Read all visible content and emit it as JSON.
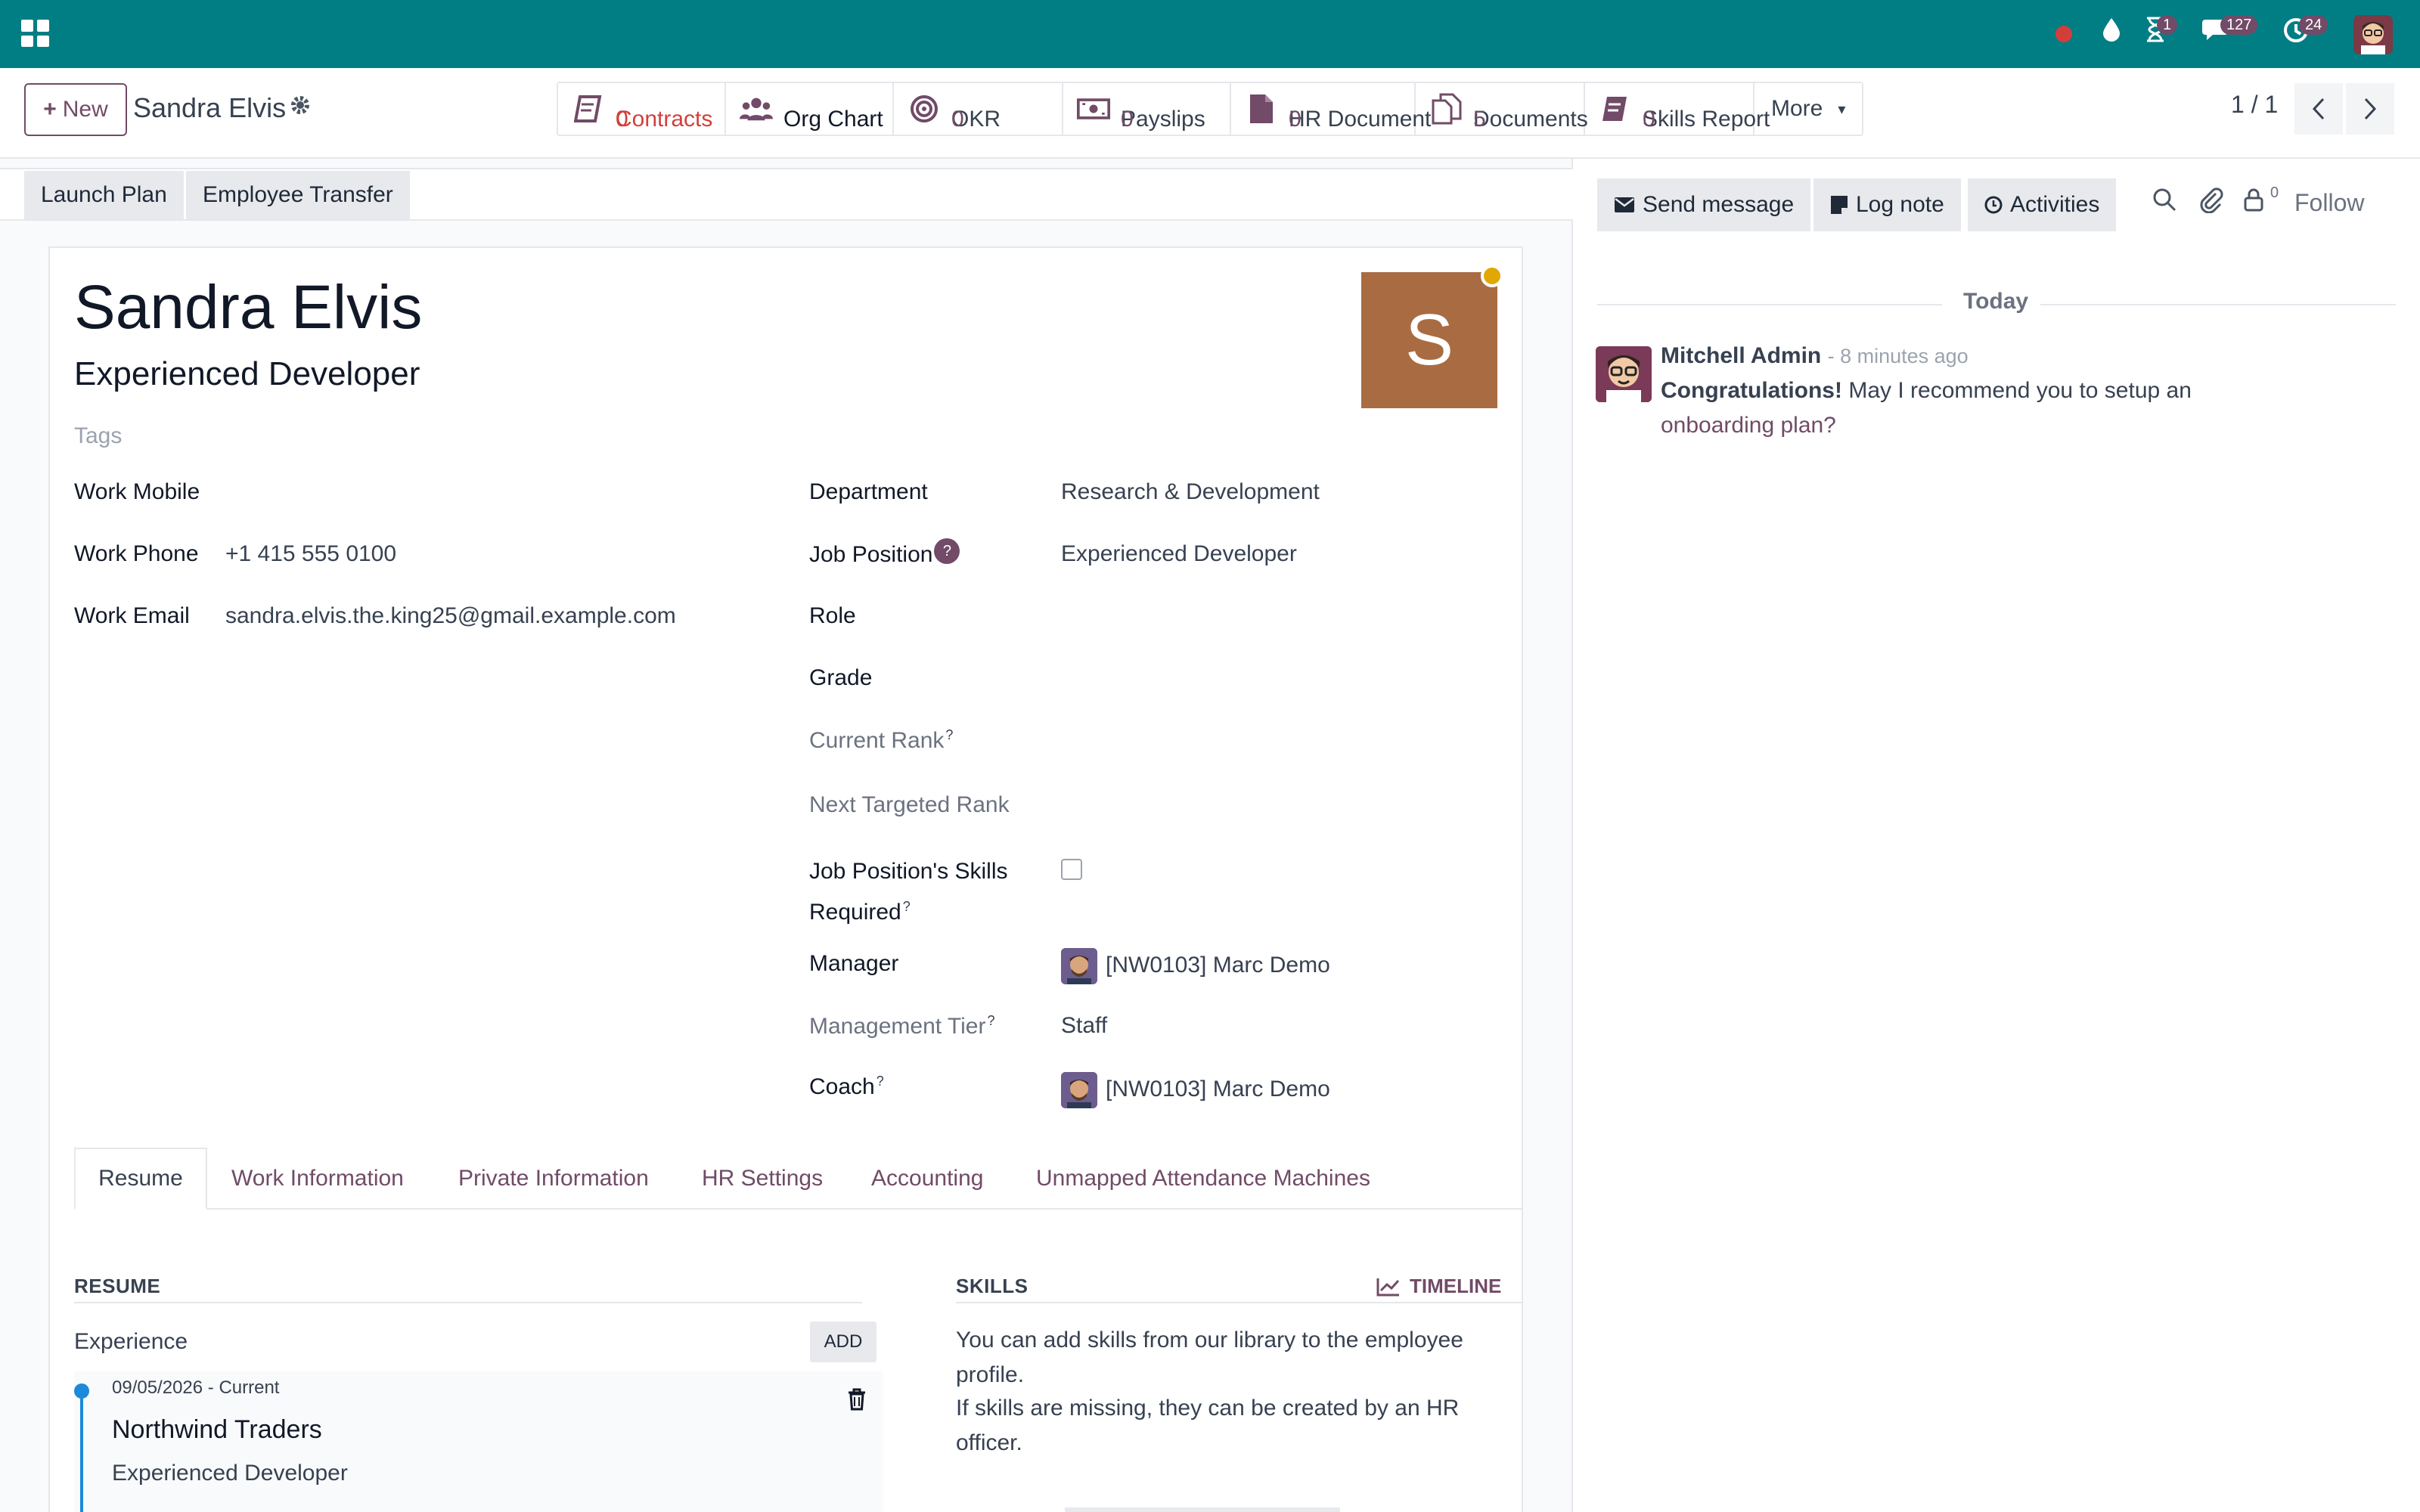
{
  "topbar": {
    "activity_badge": "1",
    "messages_badge": "127",
    "clock_badge": "24"
  },
  "control": {
    "new_label": "New",
    "record_name": "Sandra Elvis",
    "pager": "1 / 1",
    "more_label": "More"
  },
  "smart_buttons": [
    {
      "label": "Contracts",
      "value": "0",
      "icon": "contract-book-icon"
    },
    {
      "label": "Org Chart",
      "value": "",
      "icon": "org-chart-users-icon"
    },
    {
      "label": "OKR",
      "value": "0",
      "icon": "target-icon"
    },
    {
      "label": "Payslips",
      "value": "0",
      "icon": "money-bill-icon"
    },
    {
      "label": "HR Document",
      "value": "0",
      "icon": "file-icon"
    },
    {
      "label": "Documents",
      "value": "5",
      "icon": "files-icon"
    },
    {
      "label": "Skills Report",
      "value": "0",
      "icon": "book-icon"
    }
  ],
  "status_buttons": {
    "launch_plan": "Launch Plan",
    "employee_transfer": "Employee Transfer"
  },
  "employee": {
    "name": "Sandra Elvis",
    "job_title": "Experienced Developer",
    "tags_placeholder": "Tags",
    "avatar_letter": "S"
  },
  "fields_left": {
    "work_mobile_label": "Work Mobile",
    "work_mobile": "",
    "work_phone_label": "Work Phone",
    "work_phone": "+1 415 555 0100",
    "work_email_label": "Work Email",
    "work_email": "sandra.elvis.the.king25@gmail.example.com"
  },
  "fields_right": {
    "department_label": "Department",
    "department": "Research & Development",
    "job_position_label": "Job Position",
    "job_position": "Experienced Developer",
    "role_label": "Role",
    "grade_label": "Grade",
    "current_rank_label": "Current Rank",
    "next_rank_label": "Next Targeted Rank",
    "skills_required_label_1": "Job Position's Skills",
    "skills_required_label_2": "Required",
    "manager_label": "Manager",
    "manager": "[NW0103] Marc Demo",
    "management_tier_label": "Management Tier",
    "management_tier": "Staff",
    "coach_label": "Coach",
    "coach": "[NW0103] Marc Demo",
    "help_mark": "?"
  },
  "tabs": [
    "Resume",
    "Work Information",
    "Private Information",
    "HR Settings",
    "Accounting",
    "Unmapped Attendance Machines"
  ],
  "resume": {
    "title": "RESUME",
    "experience_label": "Experience",
    "add_label": "ADD",
    "entry_dates": "09/05/2026 - Current",
    "entry_company": "Northwind Traders",
    "entry_role": "Experienced Developer"
  },
  "skills": {
    "title": "SKILLS",
    "timeline_label": "TIMELINE",
    "text_1": "You can add skills from our library to the employee",
    "text_2": "profile.",
    "text_3": "If skills are missing, they can be created by an HR",
    "text_4": "officer."
  },
  "chatter": {
    "send_message": "Send message",
    "log_note": "Log note",
    "activities": "Activities",
    "followers_count": "0",
    "follow": "Follow",
    "today": "Today",
    "author": "Mitchell Admin",
    "time": "- 8 minutes ago",
    "msg_bold": "Congratulations!",
    "msg_rest": "May I recommend you to setup an",
    "msg_link": "onboarding plan?"
  },
  "colors": {
    "topbar": "#017e84",
    "brand": "#714B67",
    "avatar": "#a96c42"
  }
}
